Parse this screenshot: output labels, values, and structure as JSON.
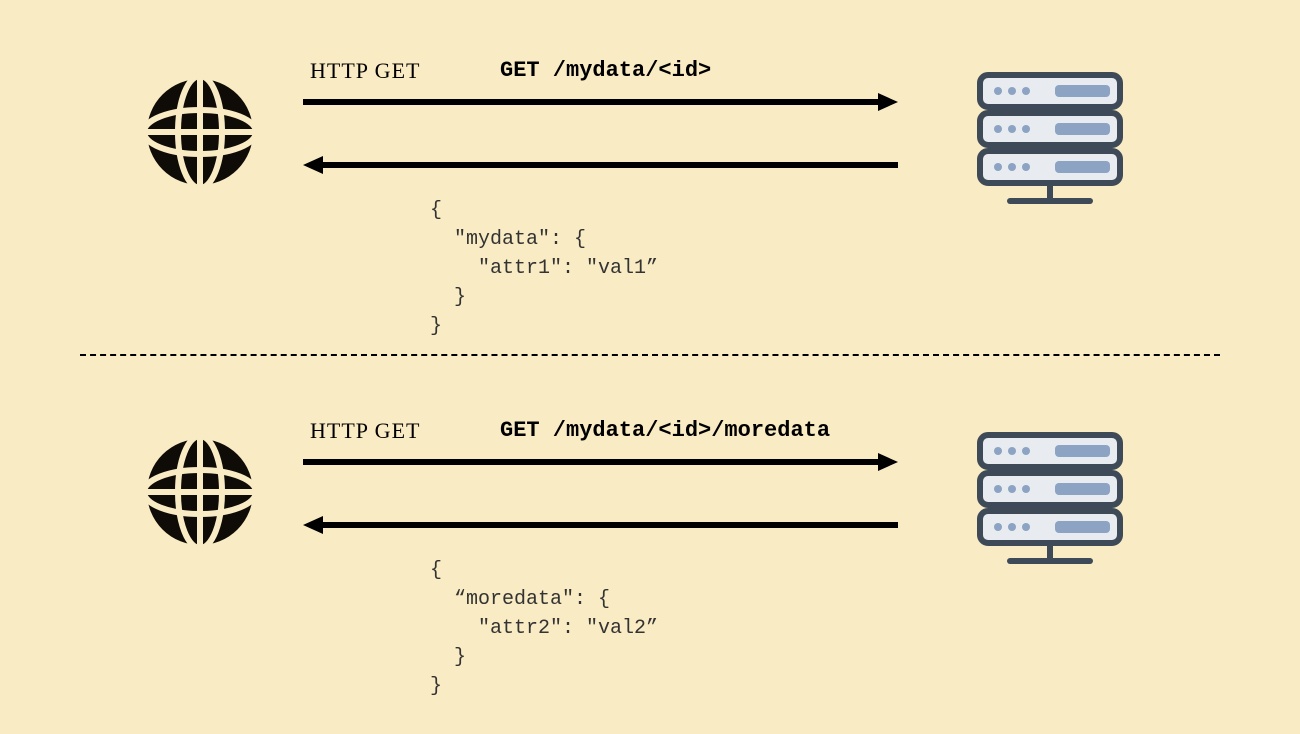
{
  "icons": {
    "client": "globe-icon",
    "server": "server-icon"
  },
  "colors": {
    "bg": "#f9ebc3",
    "ink": "#000000",
    "server_dark": "#3f4a58",
    "server_light": "#8ca3c3"
  },
  "flows": [
    {
      "method_label": "HTTP GET",
      "request_line": "GET /mydata/<id>",
      "response_body": "{\n  \"mydata\": {\n    \"attr1\": \"val1”\n  }\n}"
    },
    {
      "method_label": "HTTP GET",
      "request_line": "GET /mydata/<id>/moredata",
      "response_body": "{\n  “moredata\": {\n    \"attr2\": \"val2”\n  }\n}"
    }
  ]
}
